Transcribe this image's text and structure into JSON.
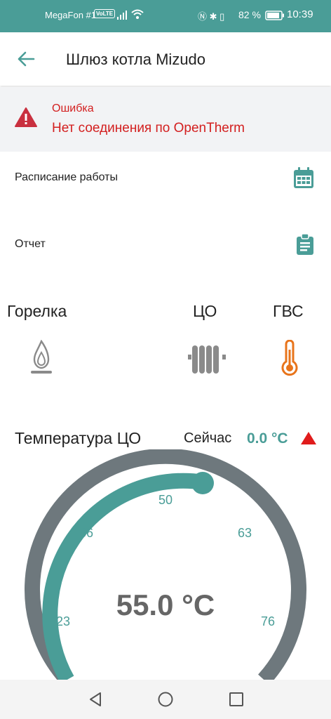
{
  "status_bar": {
    "carrier": "MegaFon #1",
    "volte": "VoLTE",
    "battery": "82 %",
    "time": "10:39"
  },
  "app_bar": {
    "title": "Шлюз котла Mizudo"
  },
  "error": {
    "title": "Ошибка",
    "message": "Нет соединения по OpenTherm"
  },
  "menu": [
    {
      "label": "Расписание работы",
      "icon": "calendar-icon"
    },
    {
      "label": "Отчет",
      "icon": "clipboard-icon"
    }
  ],
  "devices": {
    "burner": {
      "label": "Горелка",
      "icon": "flame-icon"
    },
    "heating": {
      "label": "ЦО",
      "icon": "radiator-icon"
    },
    "hot_water": {
      "label": "ГВС",
      "icon": "thermometer-icon"
    }
  },
  "temperature": {
    "title": "Температура ЦО",
    "now_label": "Сейчас",
    "now_value": "0.0 °C",
    "setpoint": "55.0 °C",
    "setpoint_value": 55.0,
    "ticks": [
      "23",
      "36",
      "50",
      "63",
      "76"
    ]
  },
  "colors": {
    "accent": "#4a9d97",
    "error": "#d31f1f",
    "hot_water": "#e8741b",
    "gauge_track": "#6e787d",
    "device_off": "#8a8a8a"
  }
}
